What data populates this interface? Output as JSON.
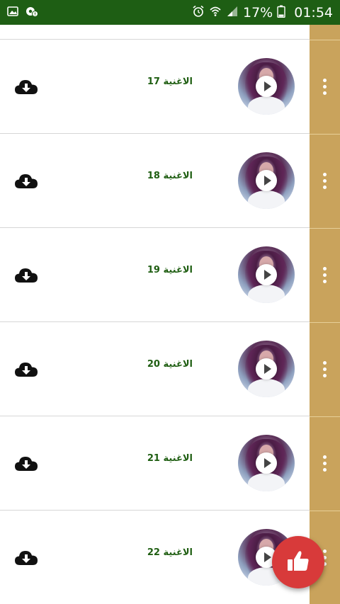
{
  "status_bar": {
    "battery_percent": "17%",
    "time": "01:54",
    "left_icons": [
      "gallery-icon",
      "settings-notification-icon"
    ],
    "right_icons": [
      "alarm-icon",
      "wifi-icon",
      "signal-icon",
      "battery-icon"
    ]
  },
  "songs": [
    {
      "title": "الاغنية 17",
      "thumbnail": "singer-photo",
      "action_icon": "cloud-download-icon"
    },
    {
      "title": "الاغنية 18",
      "thumbnail": "singer-photo",
      "action_icon": "cloud-download-icon"
    },
    {
      "title": "الاغنية 19",
      "thumbnail": "singer-photo",
      "action_icon": "cloud-download-icon"
    },
    {
      "title": "الاغنية 20",
      "thumbnail": "singer-photo",
      "action_icon": "cloud-download-icon"
    },
    {
      "title": "الاغنية 21",
      "thumbnail": "singer-photo",
      "action_icon": "cloud-download-icon"
    },
    {
      "title": "الاغنية 22",
      "thumbnail": "singer-photo",
      "action_icon": "cloud-download-icon"
    }
  ],
  "fab": {
    "icon": "thumbs-up-icon"
  },
  "colors": {
    "status_bar_bg": "#1e5e14",
    "title_green": "#1f5e12",
    "side_strip": "#c9a35c",
    "fab_red": "#d83a3a"
  }
}
